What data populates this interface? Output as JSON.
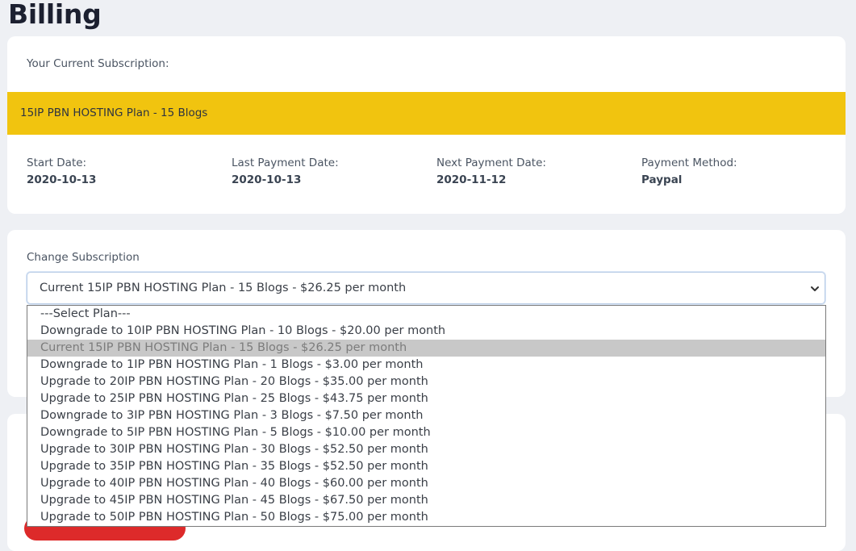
{
  "page": {
    "title": "Billing"
  },
  "current_subscription": {
    "label": "Your Current Subscription:",
    "plan_name": "15IP PBN HOSTING Plan - 15 Blogs",
    "details": [
      {
        "label": "Start Date:",
        "value": "2020-10-13"
      },
      {
        "label": "Last Payment Date:",
        "value": "2020-10-13"
      },
      {
        "label": "Next Payment Date:",
        "value": "2020-11-12"
      },
      {
        "label": "Payment Method:",
        "value": "Paypal"
      }
    ]
  },
  "change_subscription": {
    "label": "Change Subscription",
    "selected_value": "Current 15IP PBN HOSTING Plan - 15 Blogs - $26.25 per month",
    "options": [
      {
        "label": "---Select Plan---",
        "selected": false
      },
      {
        "label": "Downgrade to 10IP PBN HOSTING Plan - 10 Blogs - $20.00 per month",
        "selected": false
      },
      {
        "label": "Current 15IP PBN HOSTING Plan - 15 Blogs - $26.25 per month",
        "selected": true
      },
      {
        "label": "Downgrade to 1IP PBN HOSTING Plan - 1 Blogs - $3.00 per month",
        "selected": false
      },
      {
        "label": "Upgrade to 20IP PBN HOSTING Plan - 20 Blogs - $35.00 per month",
        "selected": false
      },
      {
        "label": "Upgrade to 25IP PBN HOSTING Plan - 25 Blogs - $43.75 per month",
        "selected": false
      },
      {
        "label": "Downgrade to 3IP PBN HOSTING Plan - 3 Blogs - $7.50 per month",
        "selected": false
      },
      {
        "label": "Downgrade to 5IP PBN HOSTING Plan - 5 Blogs - $10.00 per month",
        "selected": false
      },
      {
        "label": "Upgrade to 30IP PBN HOSTING Plan - 30 Blogs - $52.50 per month",
        "selected": false
      },
      {
        "label": "Upgrade to 35IP PBN HOSTING Plan - 35 Blogs - $52.50 per month",
        "selected": false
      },
      {
        "label": "Upgrade to 40IP PBN HOSTING Plan - 40 Blogs - $60.00 per month",
        "selected": false
      },
      {
        "label": "Upgrade to 45IP PBN HOSTING Plan - 45 Blogs - $67.50 per month",
        "selected": false
      },
      {
        "label": "Upgrade to 50IP PBN HOSTING Plan - 50 Blogs - $75.00 per month",
        "selected": false
      }
    ]
  },
  "icons": {
    "select_chevron": "chevron-down-icon"
  },
  "colors": {
    "banner": "#f1c40f",
    "background": "#eef0f4",
    "selected_option": "#c8c8c8",
    "action_button": "#dd2a2a"
  }
}
